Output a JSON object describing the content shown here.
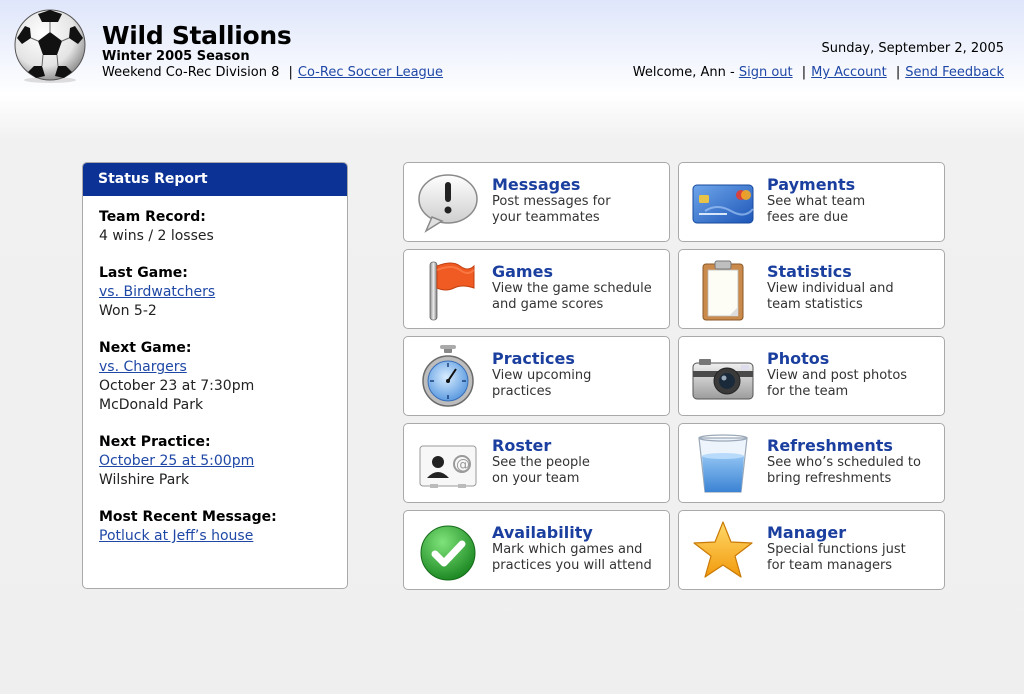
{
  "header": {
    "team_name": "Wild Stallions",
    "season": "Winter 2005 Season",
    "division": "Weekend Co-Rec Division 8",
    "league_link": "Co-Rec Soccer League",
    "date": "Sunday, September 2, 2005",
    "welcome": "Welcome, Ann -",
    "sign_out": "Sign out",
    "my_account": "My Account",
    "send_feedback": "Send Feedback",
    "separator": "|"
  },
  "status": {
    "title": "Status Report",
    "team_record_label": "Team Record:",
    "team_record_value": "4 wins / 2 losses",
    "last_game_label": "Last Game:",
    "last_game_link": "vs. Birdwatchers",
    "last_game_result": "Won 5-2",
    "next_game_label": "Next Game:",
    "next_game_link": "vs. Chargers",
    "next_game_time": "October 23 at 7:30pm",
    "next_game_place": "McDonald Park",
    "next_practice_label": "Next Practice:",
    "next_practice_link": "October 25 at 5:00pm",
    "next_practice_place": "Wilshire Park",
    "recent_message_label": "Most Recent Message:",
    "recent_message_link": "Potluck at Jeff’s house"
  },
  "features": {
    "messages": {
      "title": "Messages",
      "desc1": "Post messages for",
      "desc2": "your teammates",
      "icon": "speech-bubble-icon"
    },
    "payments": {
      "title": "Payments",
      "desc1": "See what team",
      "desc2": "fees are due",
      "icon": "credit-card-icon"
    },
    "games": {
      "title": "Games",
      "desc1": "View the game schedule",
      "desc2": "and game scores",
      "icon": "flag-icon"
    },
    "statistics": {
      "title": "Statistics",
      "desc1": "View individual and",
      "desc2": "team statistics",
      "icon": "clipboard-icon"
    },
    "practices": {
      "title": "Practices",
      "desc1": "View upcoming",
      "desc2": "practices",
      "icon": "stopwatch-icon"
    },
    "photos": {
      "title": "Photos",
      "desc1": "View and post photos",
      "desc2": "for the team",
      "icon": "camera-icon"
    },
    "roster": {
      "title": "Roster",
      "desc1": "See the people",
      "desc2": "on your team",
      "icon": "contact-card-icon"
    },
    "refreshments": {
      "title": "Refreshments",
      "desc1": "See who’s scheduled to",
      "desc2": "bring refreshments",
      "icon": "water-glass-icon"
    },
    "availability": {
      "title": "Availability",
      "desc1": "Mark which games and",
      "desc2": "practices you will attend",
      "icon": "checkmark-icon"
    },
    "manager": {
      "title": "Manager",
      "desc1": "Special functions just",
      "desc2": "for team managers",
      "icon": "star-icon"
    }
  },
  "colors": {
    "accent_blue": "#0d3295",
    "title_blue": "#1b3f9f",
    "link_blue": "#1f48a6"
  }
}
